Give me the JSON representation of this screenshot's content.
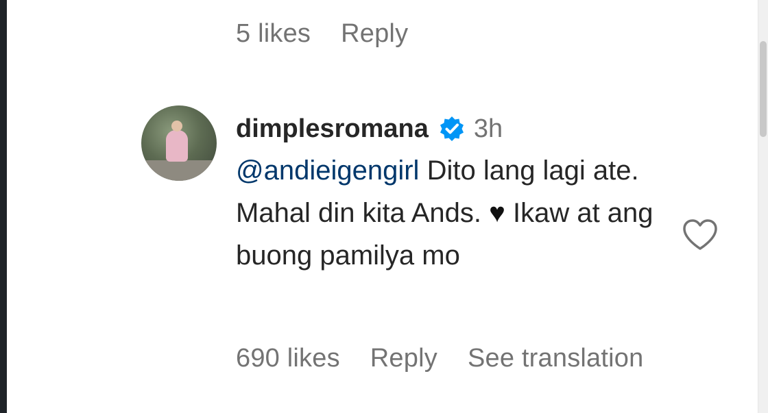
{
  "previous_comment": {
    "likes": "5 likes",
    "reply_label": "Reply"
  },
  "comment": {
    "username": "dimplesromana",
    "time": "3h",
    "mention": "@andieigengirl",
    "text_part_1": " Dito lang lagi ate. Mahal din kita Ands. ",
    "emoji": "♥",
    "text_part_2": " Ikaw at ang buong pamilya mo",
    "likes": "690 likes",
    "reply_label": "Reply",
    "translate_label": "See translation"
  },
  "icons": {
    "verified": "verified-badge-icon",
    "like": "heart-outline-icon"
  },
  "colors": {
    "verified_blue": "#0095f6",
    "mention_blue": "#00376b",
    "muted_gray": "#737373",
    "text_dark": "#262626"
  }
}
